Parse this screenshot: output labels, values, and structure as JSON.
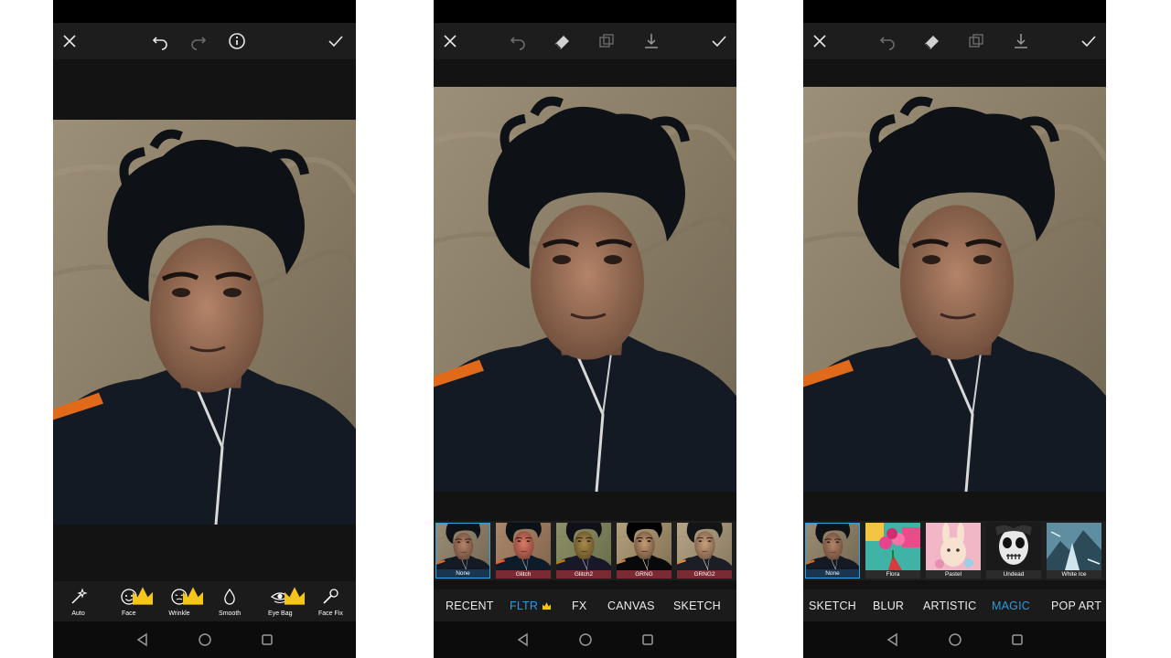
{
  "screens": [
    {
      "tools": [
        {
          "label": "Auto",
          "icon": "magic-wand-icon",
          "premium": false
        },
        {
          "label": "Face",
          "icon": "face-icon",
          "premium": true
        },
        {
          "label": "Wrinkle",
          "icon": "wrinkle-face-icon",
          "premium": true
        },
        {
          "label": "Smooth",
          "icon": "drop-icon",
          "premium": false
        },
        {
          "label": "Eye Bag",
          "icon": "eye-icon",
          "premium": true
        },
        {
          "label": "Face Fix",
          "icon": "brush-icon",
          "premium": false
        }
      ]
    },
    {
      "thumbnails": [
        {
          "label": "None",
          "selected": true
        },
        {
          "label": "Glitch",
          "selected": false
        },
        {
          "label": "Glitch2",
          "selected": false
        },
        {
          "label": "GRNG",
          "selected": false
        },
        {
          "label": "GRNG2",
          "selected": false
        }
      ],
      "categories": [
        {
          "label": "RECENT",
          "active": false
        },
        {
          "label": "FLTR",
          "active": true,
          "premium": true
        },
        {
          "label": "FX",
          "active": false
        },
        {
          "label": "CANVAS",
          "active": false
        },
        {
          "label": "SKETCH",
          "active": false
        }
      ]
    },
    {
      "thumbnails": [
        {
          "label": "None",
          "selected": true
        },
        {
          "label": "Flora",
          "selected": false
        },
        {
          "label": "Pastel",
          "selected": false
        },
        {
          "label": "Undead",
          "selected": false
        },
        {
          "label": "White Ice",
          "selected": false
        }
      ],
      "categories": [
        {
          "label": "SKETCH",
          "active": false
        },
        {
          "label": "BLUR",
          "active": false
        },
        {
          "label": "ARTISTIC",
          "active": false
        },
        {
          "label": "MAGIC",
          "active": true
        },
        {
          "label": "POP ART",
          "active": false
        }
      ]
    }
  ],
  "colors": {
    "accent": "#2f9ae0",
    "premium": "#f5c518",
    "toolbar": "#1d1d1d",
    "background": "#131313"
  }
}
